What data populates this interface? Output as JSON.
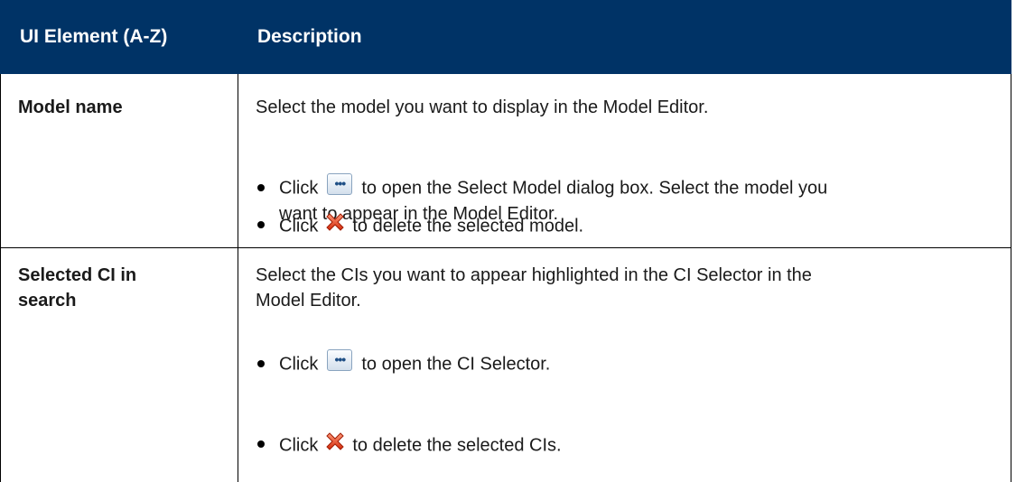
{
  "table": {
    "headers": {
      "element": "UI Element (A-Z)",
      "description": "Description"
    },
    "rows": [
      {
        "element": "Model name",
        "description": "Select the model you want to display in the Model Editor.",
        "bullets": [
          {
            "prefix": "Click",
            "icon": "browse-icon",
            "suffix_line1": "to open the Select Model dialog box. Select the model you",
            "suffix_line2": "want to appear in the Model Editor."
          },
          {
            "prefix": "Click",
            "icon": "delete-icon",
            "suffix": "to delete the selected model."
          }
        ]
      },
      {
        "element_line1": "Selected CI in",
        "element_line2": "search",
        "description_line1": "Select the CIs you want to appear highlighted in the CI Selector in the",
        "description_line2": "Model Editor.",
        "bullets": [
          {
            "prefix": "Click",
            "icon": "browse-icon",
            "suffix": "to open the CI Selector."
          },
          {
            "prefix": "Click",
            "icon": "delete-icon",
            "suffix": "to delete the selected CIs."
          }
        ]
      }
    ]
  },
  "colors": {
    "header_bg": "#003366",
    "header_text": "#ffffff",
    "grid": "#000000"
  }
}
